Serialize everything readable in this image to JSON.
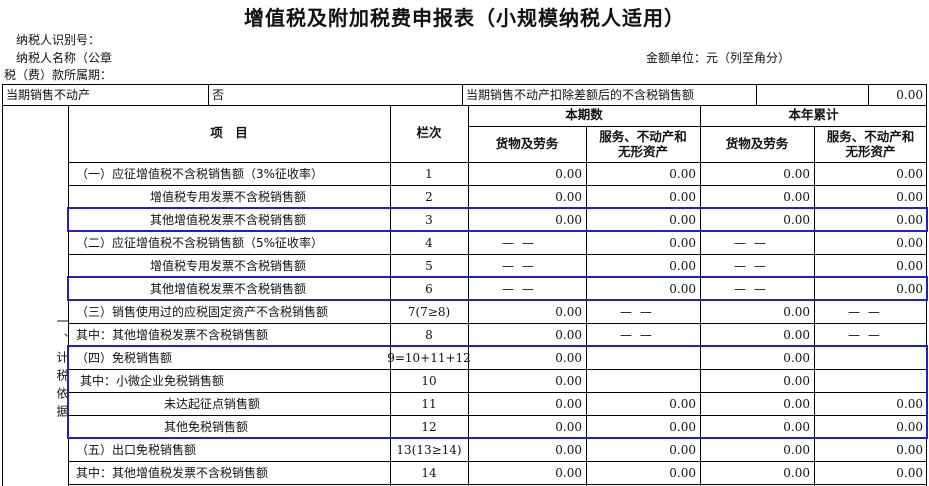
{
  "title": "增值税及附加税费申报表（小规模纳税人适用）",
  "taxpayer_id_label": "纳税人识别号：",
  "taxpayer_name_label": "纳税人名称（公章",
  "period_label": "税（费）款所属期：",
  "unit_label": "金额单位：元（列至角分）",
  "realestate": {
    "label": "当期销售不动产",
    "value": "否",
    "deduct_label": "当期销售不动产扣除差额后的不含税销售额",
    "deduct_value": "0.00"
  },
  "headers": {
    "item": "项　目",
    "col": "栏次",
    "current": "本期数",
    "ytd": "本年累计",
    "goods": "货物及劳务",
    "services_l1": "服务、不动产和",
    "services_l2": "无形资产"
  },
  "section_label": "一、计税依据",
  "rows": [
    {
      "label": "（一）应征增值税不含税销售额（3%征收率）",
      "col": "1",
      "c1": "0.00",
      "c2": "0.00",
      "c3": "0.00",
      "c4": "0.00"
    },
    {
      "label": "增值税专用发票不含税销售额",
      "col": "2",
      "c1": "0.00",
      "c2": "0.00",
      "c3": "0.00",
      "c4": "0.00"
    },
    {
      "label": "其他增值税发票不含税销售额",
      "col": "3",
      "c1": "0.00",
      "c2": "0.00",
      "c3": "0.00",
      "c4": "0.00"
    },
    {
      "label": "（二）应征增值税不含税销售额（5%征收率）",
      "col": "4",
      "c1": "— —",
      "c2": "0.00",
      "c3": "— —",
      "c4": "0.00"
    },
    {
      "label": "增值税专用发票不含税销售额",
      "col": "5",
      "c1": "— —",
      "c2": "0.00",
      "c3": "— —",
      "c4": "0.00"
    },
    {
      "label": "其他增值税发票不含税销售额",
      "col": "6",
      "c1": "— —",
      "c2": "0.00",
      "c3": "— —",
      "c4": "0.00"
    },
    {
      "label": "（三）销售使用过的应税固定资产不含税销售额",
      "col": "7(7≥8)",
      "c1": "0.00",
      "c2": "— —",
      "c3": "0.00",
      "c4": "— —"
    },
    {
      "label": "其中：其他增值税发票不含税销售额",
      "col": "8",
      "c1": "0.00",
      "c2": "— —",
      "c3": "0.00",
      "c4": "— —"
    },
    {
      "label": "（四）免税销售额",
      "col": "9=10+11+12",
      "c1": "0.00",
      "c2": "",
      "c3": "0.00",
      "c4": ""
    },
    {
      "label": "其中：小微企业免税销售额",
      "col": "10",
      "c1": "0.00",
      "c2": "",
      "c3": "0.00",
      "c4": ""
    },
    {
      "label": "未达起征点销售额",
      "col": "11",
      "c1": "0.00",
      "c2": "0.00",
      "c3": "0.00",
      "c4": "0.00"
    },
    {
      "label": "其他免税销售额",
      "col": "12",
      "c1": "0.00",
      "c2": "0.00",
      "c3": "0.00",
      "c4": "0.00"
    },
    {
      "label": "（五）出口免税销售额",
      "col": "13(13≥14)",
      "c1": "0.00",
      "c2": "0.00",
      "c3": "0.00",
      "c4": "0.00"
    },
    {
      "label": "其中：其他增值税发票不含税销售额",
      "col": "14",
      "c1": "0.00",
      "c2": "0.00",
      "c3": "0.00",
      "c4": "0.00"
    }
  ]
}
